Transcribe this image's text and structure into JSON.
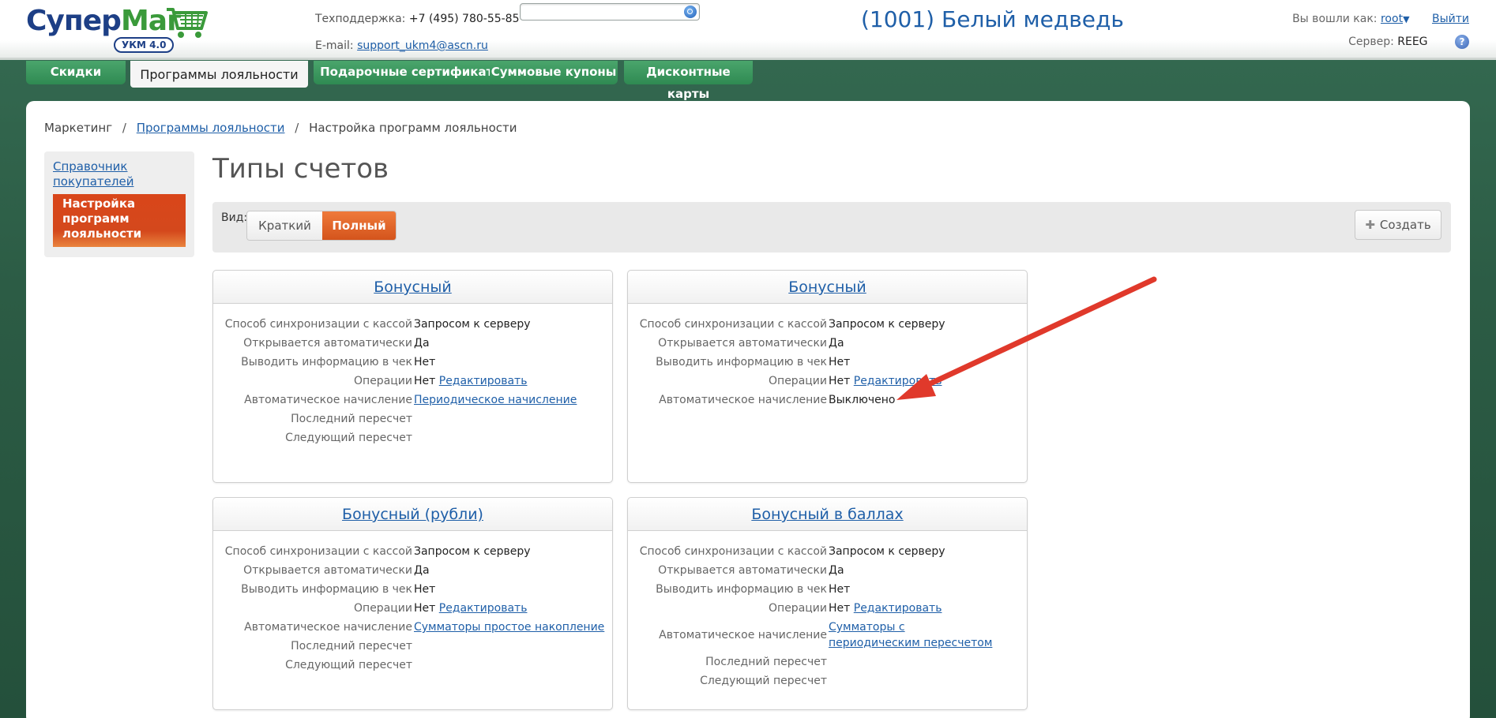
{
  "header": {
    "logo_main": "Супер",
    "logo_accent": "Маг",
    "logo_badge": "УКМ 4.0",
    "support_label": "Техподдержка:",
    "support_phone": "+7 (495) 780-55-85",
    "email_label": "E-mail:",
    "email": "support_ukm4@ascn.ru",
    "search_value": "",
    "shop_title": "(1001) Белый медведь",
    "logged_in_label": "Вы вошли как:",
    "user": "root",
    "logout": "Выйти",
    "server_label": "Сервер:",
    "server": "REEG",
    "help": "?"
  },
  "tabs": [
    {
      "label": "Скидки"
    },
    {
      "label": "Программы лояльности"
    },
    {
      "label": "Подарочные сертификаты"
    },
    {
      "label": "Суммовые купоны"
    },
    {
      "label": "Дисконтные карты"
    }
  ],
  "breadcrumb": {
    "root": "Маркетинг",
    "sep": "/",
    "link": "Программы лояльности",
    "current": "Настройка программ лояльности"
  },
  "sidenav": {
    "item1": "Справочник покупателей",
    "item2": "Настройка программ лояльности"
  },
  "page_title": "Типы счетов",
  "toolbar": {
    "view_label": "Вид:",
    "short": "Краткий",
    "full": "Полный",
    "create": "Создать"
  },
  "labels": {
    "sync": "Способ синхронизации с кассой",
    "auto_open": "Открывается автоматически",
    "print": "Выводить информацию в чек",
    "ops": "Операции",
    "auto_accrual": "Автоматическое начисление",
    "last": "Последний пересчет",
    "next": "Следующий пересчет"
  },
  "cards": [
    {
      "title": "Бонусный",
      "sync": "Запросом к серверу",
      "auto_open": "Да",
      "print": "Нет",
      "ops": "Нет",
      "ops_link": "Редактировать",
      "auto_accrual": "Периодическое начисление"
    },
    {
      "title": "Бонусный",
      "sync": "Запросом к серверу",
      "auto_open": "Да",
      "print": "Нет",
      "ops": "Нет",
      "ops_link": "Редактировать",
      "auto_accrual": "Выключено"
    },
    {
      "title": "Бонусный (рубли)",
      "sync": "Запросом к серверу",
      "auto_open": "Да",
      "print": "Нет",
      "ops": "Нет",
      "ops_link": "Редактировать",
      "auto_accrual": "Сумматоры простое накопление"
    },
    {
      "title": "Бонусный в баллах",
      "sync": "Запросом к серверу",
      "auto_open": "Да",
      "print": "Нет",
      "ops": "Нет",
      "ops_link": "Редактировать",
      "auto_accrual": "Сумматоры с периодическим пересчетом"
    }
  ],
  "colors": {
    "brand_green": "#2f8a52",
    "accent_orange": "#d4541c",
    "link_blue": "#1f5fa8",
    "annotation_red": "#e0392b"
  }
}
